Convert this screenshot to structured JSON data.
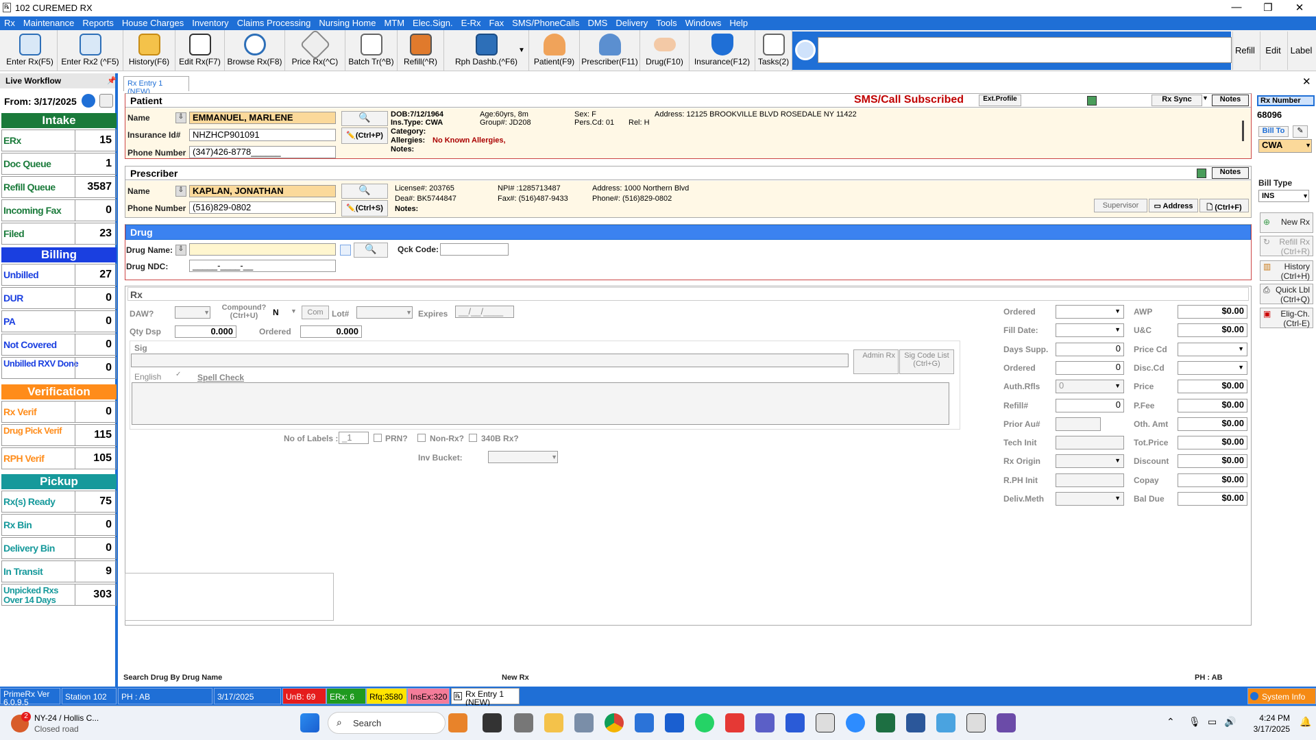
{
  "app": {
    "title": "102 CUREMED RX"
  },
  "menu": [
    "Rx",
    "Maintenance",
    "Reports",
    "House Charges",
    "Inventory",
    "Claims Processing",
    "Nursing Home",
    "MTM",
    "Elec.Sign.",
    "E-Rx",
    "Fax",
    "SMS/PhoneCalls",
    "DMS",
    "Delivery",
    "Tools",
    "Windows",
    "Help"
  ],
  "toolbar": {
    "buttons": [
      {
        "label": "Enter Rx(F5)",
        "icon": "enter-rx-icon"
      },
      {
        "label": "Enter Rx2 (^F5)",
        "icon": "enter-rx2-icon"
      },
      {
        "label": "History(F6)",
        "icon": "history-folder-icon"
      },
      {
        "label": "Edit Rx(F7)",
        "icon": "edit-pencil-icon"
      },
      {
        "label": "Browse Rx(F8)",
        "icon": "browse-magnifier-icon"
      },
      {
        "label": "Price Rx(^C)",
        "icon": "price-tag-icon"
      },
      {
        "label": "Batch Tr(^B)",
        "icon": "antenna-icon"
      },
      {
        "label": "Refill(^R)",
        "icon": "refill-bottle-icon"
      },
      {
        "label": "Rph Dashb.(^F6)",
        "icon": "dashboard-monitor-icon"
      },
      {
        "label": "Patient(F9)",
        "icon": "patient-icon"
      },
      {
        "label": "Prescriber(F11)",
        "icon": "doctor-icon"
      },
      {
        "label": "Drug(F10)",
        "icon": "pill-icon"
      },
      {
        "label": "Insurance(F12)",
        "icon": "shield-icon"
      },
      {
        "label": "Tasks(2)",
        "icon": "tasks-icon"
      }
    ],
    "right": [
      "Refill",
      "Edit",
      "Label"
    ]
  },
  "left": {
    "from": "From: 3/17/2025",
    "intake": "Intake",
    "billing": "Billing",
    "verification": "Verification",
    "pickup": "Pickup",
    "intake_rows": [
      {
        "name": "ERx",
        "count": "15"
      },
      {
        "name": "Doc Queue",
        "count": "1"
      },
      {
        "name": "Refill Queue",
        "count": "3587"
      },
      {
        "name": "Incoming Fax",
        "count": "0"
      },
      {
        "name": "Filed",
        "count": "23"
      }
    ],
    "billing_rows": [
      {
        "name": "Unbilled",
        "count": "27"
      },
      {
        "name": "DUR",
        "count": "0"
      },
      {
        "name": "PA",
        "count": "0"
      },
      {
        "name": "Not Covered",
        "count": "0"
      },
      {
        "name": "Unbilled RXV Done",
        "count": "0"
      }
    ],
    "verif_rows": [
      {
        "name": "Rx Verif",
        "count": "0"
      },
      {
        "name": "Drug Pick Verif",
        "count": "115"
      },
      {
        "name": "RPH Verif",
        "count": "105"
      }
    ],
    "pickup_rows": [
      {
        "name": "Rx(s) Ready",
        "count": "75"
      },
      {
        "name": "Rx Bin",
        "count": "0"
      },
      {
        "name": "Delivery Bin",
        "count": "0"
      },
      {
        "name": "In Transit",
        "count": "9"
      },
      {
        "name": "Unpicked Rxs Over 14 Days",
        "count": "303"
      }
    ]
  },
  "live_workflow": "Live Workflow",
  "tab": "Rx Entry 1 (NEW)",
  "patient": {
    "header": "Patient",
    "sms": "SMS/Call Subscribed",
    "ext_profile": "Ext.Profile",
    "rx_sync": "Rx Sync",
    "notes": "Notes",
    "name_label": "Name",
    "name": "EMMANUEL, MARLENE",
    "ins_label": "Insurance Id#",
    "ins_id": "NHZHCP901091",
    "phone_label": "Phone Number",
    "phone": "(347)426-8778______",
    "ctrlp": "(Ctrl+P)",
    "dob": "DOB:7/12/1964",
    "ins_type": "Ins.Type:  CWA",
    "category": "Category:",
    "allergies_l": "Allergies:",
    "allergies": "No Known Allergies,",
    "notes_l": "Notes:",
    "age": "Age:60yrs, 8m",
    "group": "Group#:  JD208",
    "sex": "Sex:         F",
    "pers": "Pers.Cd:  01",
    "rel": "Rel:  H",
    "address": "Address:  12125 BROOKVILLE BLVD  ROSEDALE NY 11422"
  },
  "prescriber": {
    "header": "Prescriber",
    "notes": "Notes",
    "name_label": "Name",
    "name": "KAPLAN, JONATHAN",
    "phone_label": "Phone Number",
    "phone": "(516)829-0802",
    "ctrls": "(Ctrl+S)",
    "license": "License#:  203765",
    "dea": "Dea#:        BK5744847",
    "notes_l": "Notes:",
    "npi": "NPI# :1285713487",
    "fax": "Fax#:  (516)487-9433",
    "address": "Address:  1000 Northern Blvd",
    "phone2": "Phone#:  (516)829-0802",
    "supervisor": "Supervisor",
    "address_btn": "Address",
    "ctrlf": "(Ctrl+F)"
  },
  "drug": {
    "header": "Drug",
    "name_label": "Drug Name:",
    "qck": "Qck Code:",
    "ndc_label": "Drug NDC:",
    "ndc": "_____-____-__"
  },
  "rx": {
    "header": "Rx",
    "daw": "DAW?",
    "compound": "Compound? (Ctrl+U)",
    "compound_val": "N",
    "com": "Com",
    "lot": "Lot#",
    "expires": "Expires",
    "expires_val": "__/__/____",
    "qty": "Qty Dsp",
    "qty_val": "0.000",
    "ordered": "Ordered",
    "ordered_val": "0.000",
    "sig": "Sig",
    "admin_rx": "Admin Rx",
    "sig_code": "Sig Code List (Ctrl+G)",
    "english": "English",
    "spell": "Spell Check",
    "labels": "No of Labels :",
    "labels_val": "_1",
    "prn": "PRN?",
    "nonrx": "Non-Rx?",
    "b340": "340B Rx?",
    "inv": "Inv Bucket:"
  },
  "rxright": {
    "left_labels": [
      "Ordered",
      "Fill Date:",
      "Days Supp.",
      "Ordered",
      "Auth.Rfls",
      "Refill#",
      "Prior Au#",
      "Tech Init",
      "Rx Origin",
      "R.PH Init",
      "Deliv.Meth"
    ],
    "left_vals": [
      "",
      "",
      "0",
      "0",
      "0",
      "0",
      "",
      "",
      "",
      "",
      ""
    ],
    "right_labels": [
      "AWP",
      "U&C",
      "Price Cd",
      "Disc.Cd",
      "Price",
      "P.Fee",
      "Oth. Amt",
      "Tot.Price",
      "Discount",
      "Copay",
      "Bal Due"
    ],
    "right_vals": [
      "$0.00",
      "$0.00",
      "",
      "",
      "$0.00",
      "$0.00",
      "$0.00",
      "$0.00",
      "$0.00",
      "$0.00",
      "$0.00"
    ]
  },
  "rightside": {
    "rx_number": "Rx Number",
    "rx_num_val": "68096",
    "bill_to": "Bill To",
    "cwa": "CWA",
    "bill_type": "Bill Type",
    "ins": "INS",
    "buttons": [
      "New Rx",
      "Refill Rx (Ctrl+R)",
      "History (Ctrl+H)",
      "Quick Lbl (Ctrl+Q)",
      "Elig-Ch. (Ctrl-E)"
    ]
  },
  "footer": {
    "left": "Search Drug By Drug Name",
    "mid": "New Rx",
    "right": "PH : AB"
  },
  "status": {
    "ver": "PrimeRx Ver 6.0.9.5",
    "station": "Station 102",
    "ph": "PH : AB",
    "date": "3/17/2025",
    "unb": "UnB: 69",
    "erx": "ERx: 6",
    "rfq": "Rfq:3580",
    "insex": "InsEx:320",
    "rxentry": "Rx Entry 1 (NEW)",
    "sysinfo": "System Info"
  },
  "taskbar": {
    "weather": "NY-24 / Hollis C...",
    "weather2": "Closed road",
    "badge": "2",
    "search": "Search",
    "time": "4:24 PM",
    "date": "3/17/2025"
  },
  "colors": {
    "accent": "#1f6fd6",
    "intake": "#1a7a3a",
    "billing": "#1a3fe0",
    "verification": "#ff8c1a",
    "pickup": "#16999b"
  }
}
